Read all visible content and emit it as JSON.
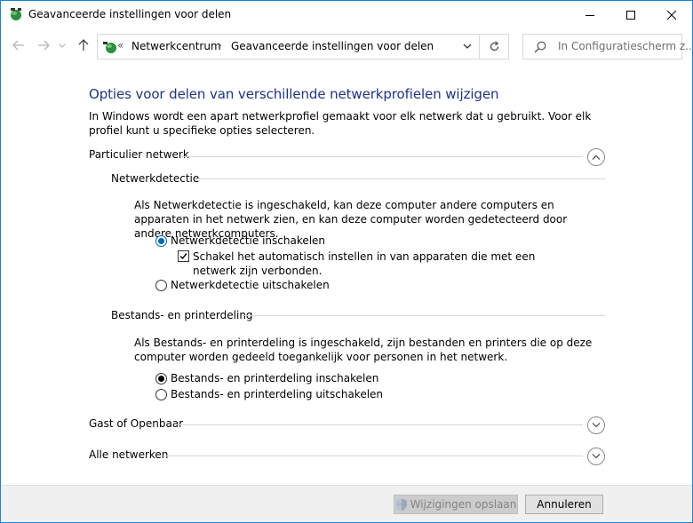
{
  "window": {
    "title": "Geavanceerde instellingen voor delen"
  },
  "address": {
    "chevron": "«",
    "crumb1": "Netwerkcentrum",
    "separator": "›",
    "crumb2": "Geavanceerde instellingen voor delen",
    "search_placeholder": "In Configuratiescherm z..."
  },
  "main": {
    "heading": "Opties voor delen van verschillende netwerkprofielen wijzigen",
    "intro": "In Windows wordt een apart netwerkprofiel gemaakt voor elk netwerk dat u gebruikt. Voor elk profiel kunt u specifieke opties selecteren.",
    "private": {
      "title": "Particulier netwerk",
      "expanded": true,
      "discovery": {
        "title": "Netwerkdetectie",
        "description": "Als Netwerkdetectie is ingeschakeld, kan deze computer andere computers en apparaten in het netwerk zien, en kan deze computer worden gedetecteerd door andere netwerkcomputers.",
        "on_label": "Netwerkdetectie inschakelen",
        "auto_setup_label": "Schakel het automatisch instellen in van apparaten die met een netwerk zijn verbonden.",
        "auto_setup_checked": true,
        "off_label": "Netwerkdetectie uitschakelen",
        "selected": "on"
      },
      "sharing": {
        "title": "Bestands- en printerdeling",
        "description": "Als Bestands- en printerdeling is ingeschakeld, zijn bestanden en printers die op deze computer worden gedeeld toegankelijk voor personen in het netwerk.",
        "on_label": "Bestands- en printerdeling inschakelen",
        "off_label": "Bestands- en printerdeling uitschakelen",
        "selected": "on"
      }
    },
    "guest": {
      "title": "Gast of Openbaar",
      "expanded": false
    },
    "all": {
      "title": "Alle netwerken",
      "expanded": false
    }
  },
  "footer": {
    "save_label": "Wijzigingen opslaan",
    "save_enabled": false,
    "cancel_label": "Annuleren"
  },
  "colors": {
    "heading": "#1e3287",
    "accent": "#0067c0",
    "window_border": "#1883d7"
  }
}
